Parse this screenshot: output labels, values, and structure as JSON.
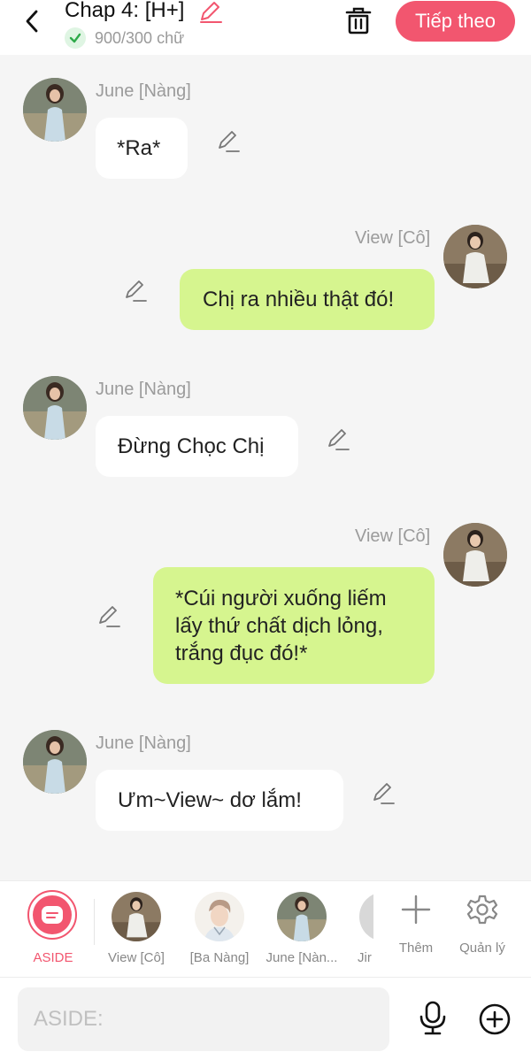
{
  "header": {
    "title": "Chap 4: [H+]",
    "word_count": "900/300 chữ",
    "next_label": "Tiếp theo"
  },
  "colors": {
    "accent": "#f2566f",
    "bubble_right": "#d6f58f",
    "bubble_left": "#ffffff",
    "background": "#f5f5f5"
  },
  "messages": [
    {
      "sender": "June [Nàng]",
      "side": "left",
      "text": "*Ra*"
    },
    {
      "sender": "View [Cô]",
      "side": "right",
      "text": "Chị ra nhiều thật đó!"
    },
    {
      "sender": "June [Nàng]",
      "side": "left",
      "text": "Đừng Chọc Chị"
    },
    {
      "sender": "View [Cô]",
      "side": "right",
      "text": "*Cúi người xuống liếm lấy thứ chất dịch lỏng, trắng đục đó!*"
    },
    {
      "sender": "June [Nàng]",
      "side": "left",
      "text": "Ưm~View~ dơ lắm!"
    }
  ],
  "characters": [
    {
      "label": "ASIDE",
      "icon": "aside-icon",
      "selected": true
    },
    {
      "label": "View [Cô]"
    },
    {
      "label": "[Ba Nàng]"
    },
    {
      "label": "June [Nàn..."
    },
    {
      "label": "Jir"
    },
    {
      "label": "Thêm",
      "icon": "plus-icon"
    },
    {
      "label": "Quản lý",
      "icon": "gear-icon"
    }
  ],
  "input": {
    "placeholder": "ASIDE:"
  },
  "icons": [
    "back-arrow-icon",
    "pencil-icon",
    "check-icon",
    "trash-icon",
    "mic-icon",
    "plus-circle-icon"
  ]
}
